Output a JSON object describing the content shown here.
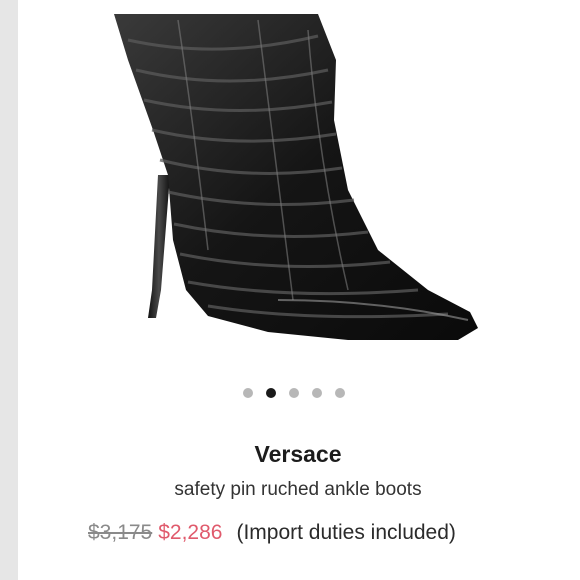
{
  "product": {
    "brand": "Versace",
    "name": "safety pin ruched ankle boots",
    "old_price": "$3,175",
    "sale_price": "$2,286",
    "duties_note": "(Import duties included)"
  },
  "carousel": {
    "count": 5,
    "active_index": 1
  },
  "colors": {
    "sale_price": "#e05a6c",
    "old_price": "#8a8a8a",
    "dot_inactive": "#b7b7b7",
    "dot_active": "#1a1a1a"
  }
}
